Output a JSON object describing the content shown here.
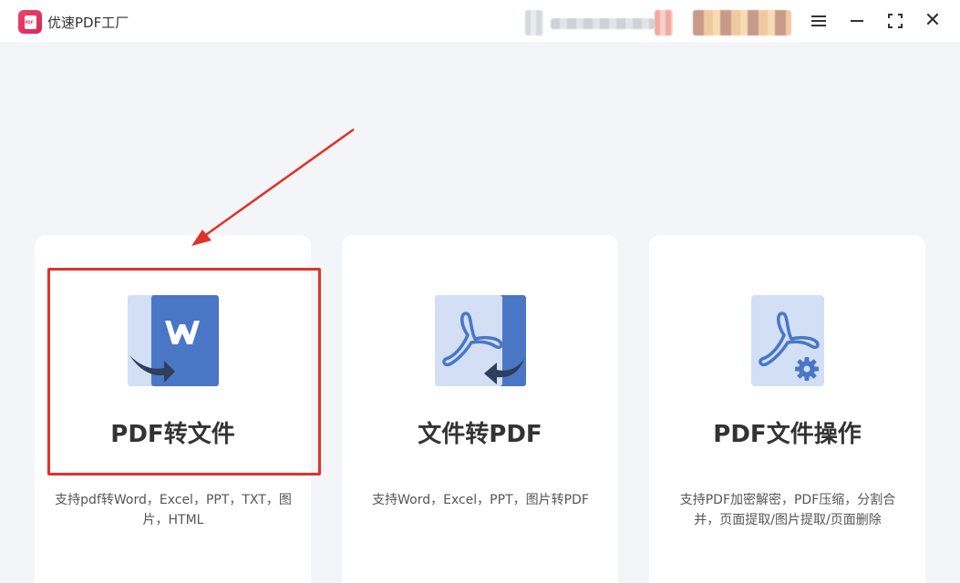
{
  "window": {
    "title": "优速PDF工厂",
    "controls": {
      "menu": "menu",
      "minimize": "minimize",
      "maximize": "maximize",
      "close": "✕"
    }
  },
  "colors": {
    "accent_blue": "#4a76c6",
    "light_blue": "#d2dff5",
    "dark_arrow": "#2f3e5c",
    "highlight_red": "#e0322a",
    "logo_pink": "#e0305f"
  },
  "cards": [
    {
      "title": "PDF转文件",
      "desc": "支持pdf转Word，Excel，PPT，TXT，图片，HTML",
      "icon": "word-convert-icon"
    },
    {
      "title": "文件转PDF",
      "desc": "支持Word，Excel，PPT，图片转PDF",
      "icon": "pdf-import-icon"
    },
    {
      "title": "PDF文件操作",
      "desc": "支持PDF加密解密，PDF压缩，分割合并，页面提取/图片提取/页面删除",
      "icon": "pdf-settings-icon"
    }
  ],
  "annotation": {
    "highlighted_card": "PDF转文件"
  }
}
